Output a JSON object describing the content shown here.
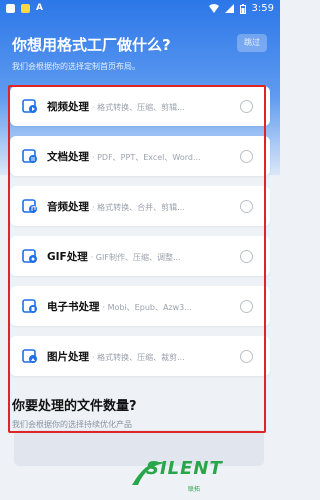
{
  "status": {
    "time": "3:59",
    "a_glyph": "A"
  },
  "header": {
    "title": "你想用格式工厂做什么?",
    "subtitle": "我们会根据你的选择定制首页布局。",
    "skip": "跳过"
  },
  "options": [
    {
      "name": "视频处理",
      "desc": "· 格式转换、压缩、剪辑...",
      "icon": "video-icon"
    },
    {
      "name": "文档处理",
      "desc": "· PDF、PPT、Excel、Word...",
      "icon": "document-icon"
    },
    {
      "name": "音频处理",
      "desc": "· 格式转换、合并、剪辑...",
      "icon": "audio-icon"
    },
    {
      "name": "GIF处理",
      "desc": "· GIF制作、压缩、调整...",
      "icon": "gif-icon"
    },
    {
      "name": "电子书处理",
      "desc": "· Mobi、Epub、Azw3...",
      "icon": "ebook-icon"
    },
    {
      "name": "图片处理",
      "desc": "· 格式转换、压缩、裁剪...",
      "icon": "image-icon"
    }
  ],
  "question2": {
    "title": "你要处理的文件数量?",
    "subtitle": "我们会根据你的选择持续优化产品"
  },
  "watermark": {
    "text": "SILENT",
    "sub": "联拓"
  },
  "colors": {
    "accent": "#2c77e8",
    "highlight": "#e02424",
    "brand": "#2aa64a"
  }
}
